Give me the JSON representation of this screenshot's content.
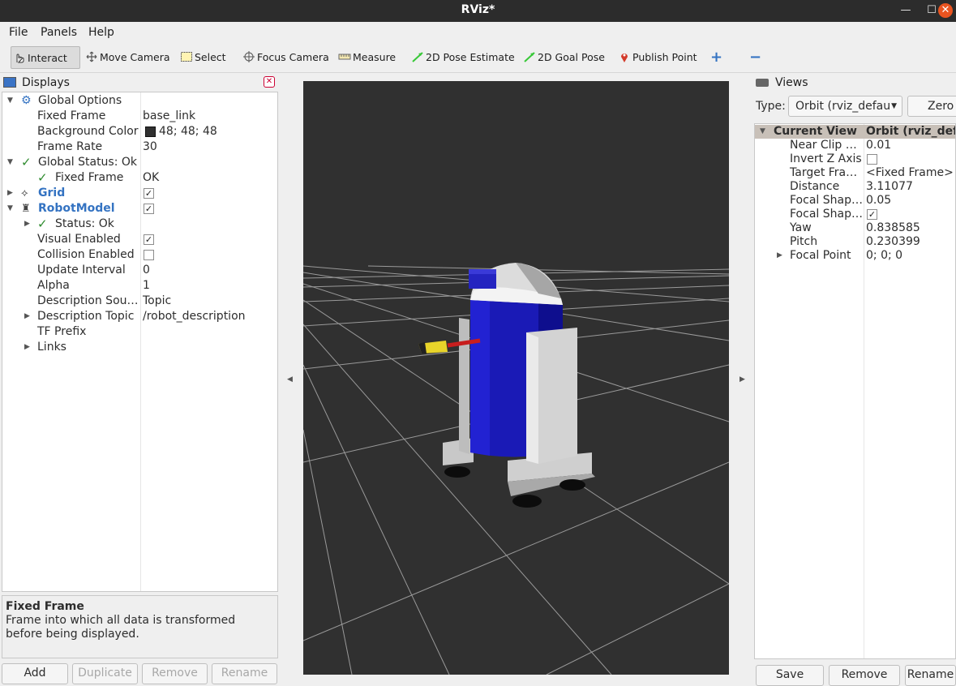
{
  "window": {
    "title": "RViz*"
  },
  "menu": [
    "File",
    "Panels",
    "Help"
  ],
  "toolbar": {
    "interact": "Interact",
    "move_camera": "Move Camera",
    "select": "Select",
    "focus_camera": "Focus Camera",
    "measure": "Measure",
    "pose_estimate": "2D Pose Estimate",
    "goal_pose": "2D Goal Pose",
    "publish_point": "Publish Point",
    "plus": "+",
    "minus": "−"
  },
  "displays": {
    "title": "Displays",
    "rows": {
      "global_options": "Global Options",
      "fixed_frame": "Fixed Frame",
      "fixed_frame_val": "base_link",
      "background_color": "Background Color",
      "background_color_val": "48; 48; 48",
      "frame_rate": "Frame Rate",
      "frame_rate_val": "30",
      "global_status": "Global Status: Ok",
      "status_fixed_frame": "Fixed Frame",
      "status_fixed_frame_val": "OK",
      "grid": "Grid",
      "robot_model": "RobotModel",
      "status_ok": "Status: Ok",
      "visual_enabled": "Visual Enabled",
      "collision_enabled": "Collision Enabled",
      "update_interval": "Update Interval",
      "update_interval_val": "0",
      "alpha": "Alpha",
      "alpha_val": "1",
      "description_source": "Description Sou…",
      "description_source_val": "Topic",
      "description_topic": "Description Topic",
      "description_topic_val": "/robot_description",
      "tf_prefix": "TF Prefix",
      "links": "Links"
    },
    "help_title": "Fixed Frame",
    "help_text": "Frame into which all data is transformed before being displayed.",
    "buttons": {
      "add": "Add",
      "duplicate": "Duplicate",
      "remove": "Remove",
      "rename": "Rename"
    }
  },
  "views": {
    "title": "Views",
    "type_label": "Type:",
    "type_value": "Orbit (rviz_defau",
    "zero": "Zero",
    "header_left": "Current View",
    "header_right": "Orbit (rviz_defa",
    "props": {
      "near_clip": "Near Clip …",
      "near_clip_val": "0.01",
      "invert_z": "Invert Z Axis",
      "target_frame": "Target Fra…",
      "target_frame_val": "<Fixed Frame>",
      "distance": "Distance",
      "distance_val": "3.11077",
      "focal_shape_size": "Focal Shap…",
      "focal_shape_size_val": "0.05",
      "focal_shape_fixed": "Focal Shap…",
      "yaw": "Yaw",
      "yaw_val": "0.838585",
      "pitch": "Pitch",
      "pitch_val": "0.230399",
      "focal_point": "Focal Point",
      "focal_point_val": "0; 0; 0"
    },
    "buttons": {
      "save": "Save",
      "remove": "Remove",
      "rename": "Rename"
    }
  },
  "colors": {
    "viewport_bg": "#303030",
    "accent_blue": "#3473c2",
    "robot_blue": "#1717b8",
    "close_orange": "#e95420"
  }
}
